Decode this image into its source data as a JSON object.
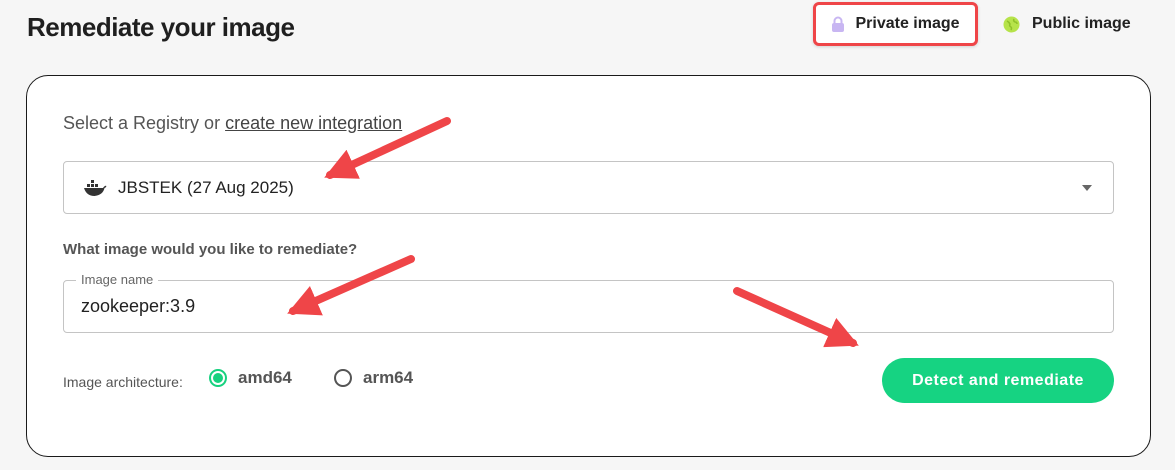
{
  "page": {
    "title": "Remediate your image"
  },
  "mode_toggle": {
    "private_label": "Private image",
    "public_label": "Public image",
    "selected": "private",
    "private_icon": "lock-icon",
    "public_icon": "globe-icon"
  },
  "registry": {
    "prompt": "Select a Registry or",
    "link_text": "create new integration",
    "selected_value": "JBSTEK (27 Aug 2025)",
    "icon": "docker-icon"
  },
  "image": {
    "question": "What image would you like to remediate?",
    "field_label": "Image name",
    "value": "zookeeper:3.9"
  },
  "architecture": {
    "label": "Image architecture:",
    "options": [
      {
        "label": "amd64",
        "selected": true
      },
      {
        "label": "arm64",
        "selected": false
      }
    ]
  },
  "actions": {
    "detect_label": "Detect and remediate"
  },
  "colors": {
    "accent_green": "#16d382",
    "annotation_red": "#ef4548",
    "lock_purple": "#c8b6f2",
    "globe_green": "#b6e34a"
  }
}
